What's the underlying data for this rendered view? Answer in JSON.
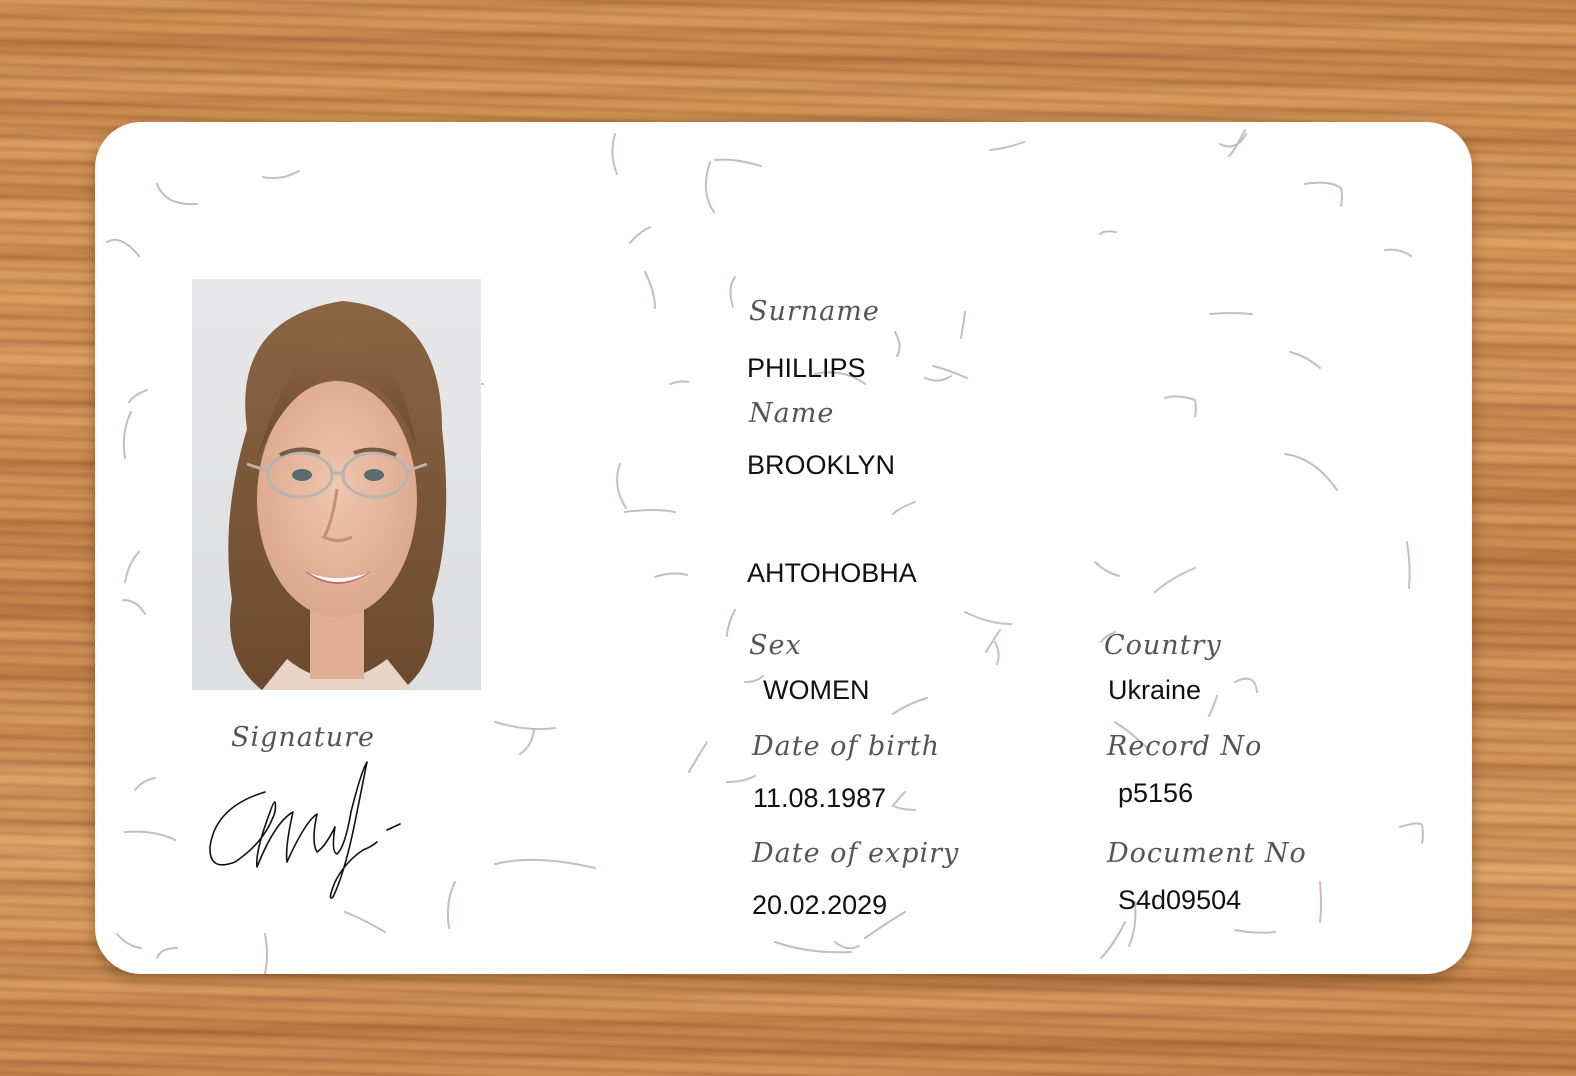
{
  "document": {
    "labels": {
      "surname": "Surname",
      "name": "Name",
      "sex": "Sex",
      "country": "Country",
      "date_of_birth": "Date of birth",
      "record_no": "Record No",
      "date_of_expiry": "Date of expiry",
      "document_no": "Document No",
      "signature": "Signature"
    },
    "values": {
      "surname": "PHILLIPS",
      "name": "BROOKLYN",
      "patronymic": "АНТОНОВНА",
      "sex": "WOMEN",
      "country": "Ukraine",
      "date_of_birth": "11.08.1987",
      "record_no": "p5156",
      "date_of_expiry": "20.02.2029",
      "document_no": "S4d09504"
    }
  },
  "colors": {
    "card": "#ffffff",
    "label_text": "#555555",
    "value_text": "#111111",
    "guilloche": "#8a6a78",
    "wood": "#c98a4e"
  }
}
